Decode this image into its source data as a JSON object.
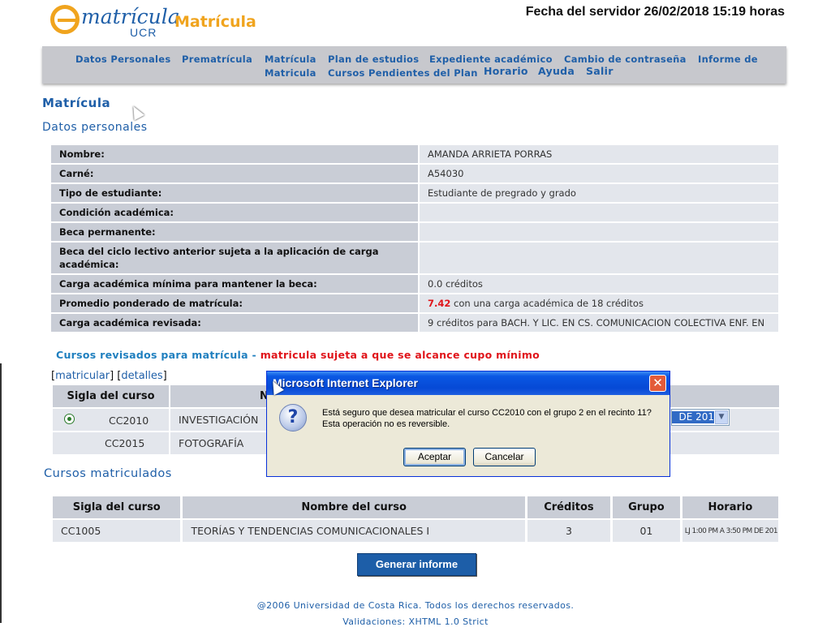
{
  "header": {
    "logo_text": "matrícula",
    "logo_sub": "UCR",
    "site_title": "Matrícula",
    "server_date": "Fecha del servidor 26/02/2018 15:19 horas"
  },
  "nav": [
    "Datos Personales",
    "Prematrícula",
    "Matrícula",
    "Plan de estudios",
    "Expediente académico",
    "Cambio de contraseña",
    "Informe de",
    "Matricula",
    "Cursos Pendientes del Plan",
    "Horario",
    "Ayuda",
    "Salir"
  ],
  "page_title": "Matrícula",
  "section_personal": "Datos personales",
  "personal": [
    {
      "k": "Nombre:",
      "v": "AMANDA ARRIETA PORRAS"
    },
    {
      "k": "Carné:",
      "v": "A54030"
    },
    {
      "k": "Tipo de estudiante:",
      "v": "Estudiante de pregrado y grado"
    },
    {
      "k": "Condición académica:",
      "v": ""
    },
    {
      "k": "Beca permanente:",
      "v": ""
    },
    {
      "k": "Beca del ciclo lectivo anterior sujeta a la aplicación de carga académica:",
      "v": ""
    },
    {
      "k": "Carga académica mínima para mantener la beca:",
      "v": "0.0 créditos"
    },
    {
      "k": "Promedio ponderado de matrícula:",
      "v_red": "7.42",
      "v": " con una carga académica de 18 créditos"
    },
    {
      "k": "Carga académica revisada:",
      "v": "9 créditos para BACH. Y LIC. EN CS. COMUNICACION COLECTIVA ENF. EN"
    }
  ],
  "revised": {
    "title": "Cursos revisados para matrícula - ",
    "warning": "matricula sujeta a que se alcance cupo mínimo",
    "link_matricular": "matricular",
    "link_detalles": "detalles",
    "col_sigla": "Sigla del curso",
    "col_nombre": "N",
    "rows": [
      {
        "sigla": "CC2010",
        "nombre": "INVESTIGACIÓN",
        "selected": true
      },
      {
        "sigla": "CC2015",
        "nombre": "FOTOGRAFÍA",
        "selected": false
      }
    ],
    "select_value": "DE 201"
  },
  "matriculated": {
    "title": "Cursos matriculados",
    "headers": [
      "Sigla del curso",
      "Nombre del curso",
      "Créditos",
      "Grupo",
      "Horario"
    ],
    "rows": [
      {
        "sigla": "CC1005",
        "nombre": "TEORÍAS Y TENDENCIAS COMUNICACIONALES I",
        "creditos": "3",
        "grupo": "01",
        "horario": "LJ 1:00 PM A 3:50 PM DE 201"
      }
    ]
  },
  "report_button": "Generar informe",
  "footer": {
    "copyright": "@2006 Universidad de Costa Rica. Todos los derechos reservados.",
    "validation": "Validaciones: XHTML 1.0 Strict"
  },
  "dialog": {
    "title": "Microsoft Internet Explorer",
    "close": "✕",
    "icon": "question-icon",
    "line1": "Está seguro que desea matricular el curso CC2010 con el grupo 2 en el recinto 11?",
    "line2": "Esta operación no es reversible.",
    "ok": "Aceptar",
    "cancel": "Cancelar"
  }
}
